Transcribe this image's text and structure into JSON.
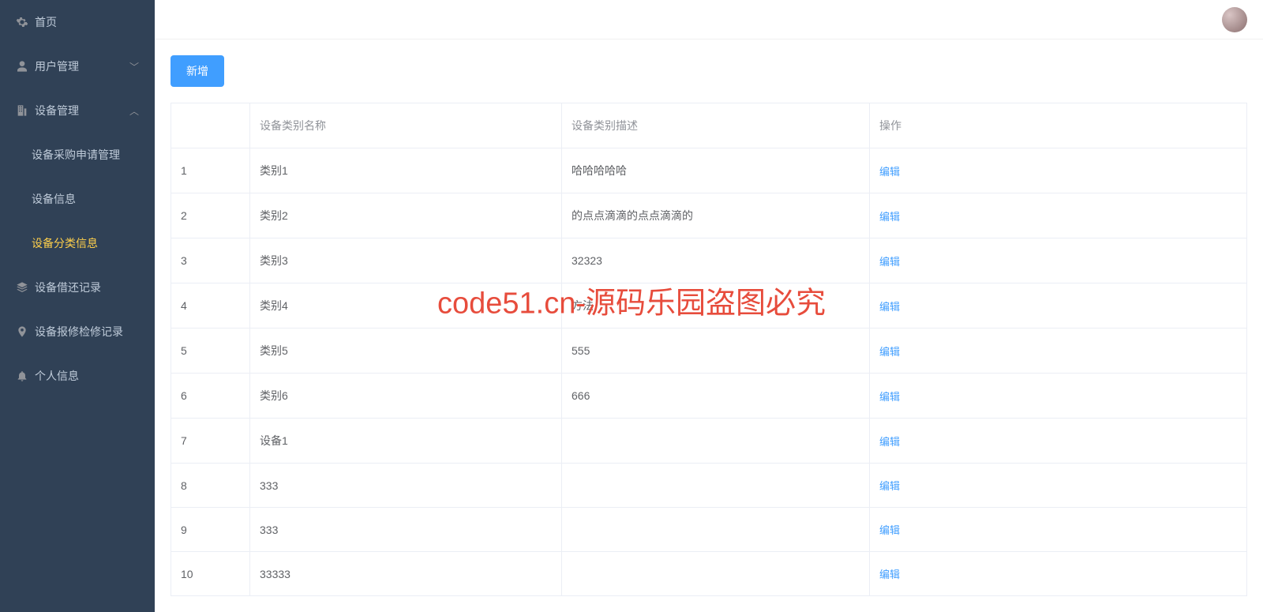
{
  "sidebar": {
    "items": [
      {
        "label": "首页",
        "icon": "gear"
      },
      {
        "label": "用户管理",
        "icon": "user",
        "arrow": "down"
      },
      {
        "label": "设备管理",
        "icon": "building",
        "arrow": "up"
      },
      {
        "label": "设备采购申请管理",
        "sub": true
      },
      {
        "label": "设备信息",
        "sub": true
      },
      {
        "label": "设备分类信息",
        "sub": true,
        "active": true
      },
      {
        "label": "设备借还记录",
        "icon": "layers"
      },
      {
        "label": "设备报修检修记录",
        "icon": "location"
      },
      {
        "label": "个人信息",
        "icon": "bell"
      }
    ]
  },
  "toolbar": {
    "add_label": "新增"
  },
  "table": {
    "headers": {
      "name": "设备类别名称",
      "desc": "设备类别描述",
      "action": "操作"
    },
    "action_label": "编辑",
    "rows": [
      {
        "idx": "1",
        "name": "类别1",
        "desc": "哈哈哈哈哈"
      },
      {
        "idx": "2",
        "name": "类别2",
        "desc": "的点点滴滴的点点滴滴的"
      },
      {
        "idx": "3",
        "name": "类别3",
        "desc": "32323"
      },
      {
        "idx": "4",
        "name": "类别4",
        "desc": "方法"
      },
      {
        "idx": "5",
        "name": "类别5",
        "desc": "555"
      },
      {
        "idx": "6",
        "name": "类别6",
        "desc": "666"
      },
      {
        "idx": "7",
        "name": "设备1",
        "desc": ""
      },
      {
        "idx": "8",
        "name": "333",
        "desc": ""
      },
      {
        "idx": "9",
        "name": "333",
        "desc": ""
      },
      {
        "idx": "10",
        "name": "33333",
        "desc": ""
      }
    ]
  },
  "watermark": "code51.cn-源码乐园盗图必究"
}
